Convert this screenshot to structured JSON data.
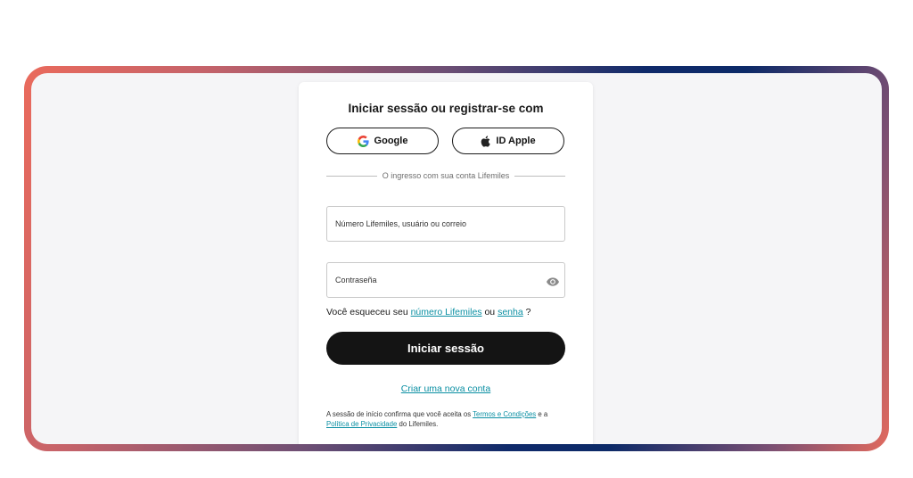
{
  "login": {
    "title": "Iniciar sessão ou registrar-se com",
    "google_label": "Google",
    "apple_label": "ID Apple",
    "divider_text": "O ingresso com sua conta Lifemiles",
    "user_placeholder": "Número Lifemiles, usuário ou correio",
    "password_placeholder": "Contraseña",
    "forgot_prefix": "Você esqueceu seu",
    "forgot_number_link": "número Lifemiles",
    "forgot_or": "ou",
    "forgot_password_link": "senha",
    "forgot_suffix": "?",
    "submit_label": "Iniciar sessão",
    "create_account_link": "Criar uma nova conta",
    "legal_prefix": "A sessão de início confirma que você aceita os",
    "terms_link": "Termos e Condições",
    "legal_and": "e a",
    "privacy_link": "Política de Privacidade",
    "legal_suffix": "do Lifemiles."
  },
  "colors": {
    "link": "#0a8fa3",
    "primary_button": "#141414",
    "frame_gradient_warm": "#ea6a5c",
    "frame_gradient_navy": "#0f2a6a"
  },
  "icons": {
    "google": "google-icon",
    "apple": "apple-icon",
    "password_toggle": "eye-icon"
  }
}
